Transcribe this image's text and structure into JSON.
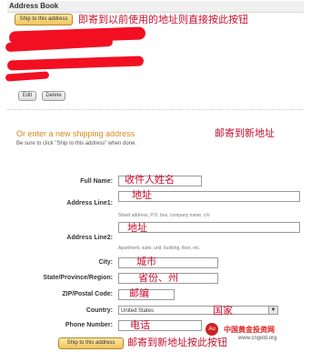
{
  "address_book": {
    "title": "Address Book",
    "ship_button": "Ship to this address",
    "annotation": "即寄到以前使用的地址则直接按此按钮",
    "edit_button": "Edit",
    "delete_button": "Delete"
  },
  "new_address": {
    "title": "Or enter a new shipping address",
    "annotation": "邮寄到新地址",
    "hint": "Be sure to click \"Ship to this address\" when done."
  },
  "form": {
    "full_name": {
      "label": "Full Name:",
      "annotation": "收件人姓名"
    },
    "address1": {
      "label": "Address Line1:",
      "annotation": "地址",
      "helper": "Street address, P.O. box, company name, c/o"
    },
    "address2": {
      "label": "Address Line2:",
      "annotation": "地址",
      "helper": "Apartment, suite, unit, building, floor, etc."
    },
    "city": {
      "label": "City:",
      "annotation": "城市"
    },
    "state": {
      "label": "State/Province/Region:",
      "annotation": "省份、州"
    },
    "zip": {
      "label": "ZIP/Postal Code:",
      "annotation": "邮编"
    },
    "country": {
      "label": "Country:",
      "value": "United States",
      "annotation": "国家"
    },
    "phone": {
      "label": "Phone Number:",
      "annotation": "电话"
    }
  },
  "submit": {
    "label": "Ship to this address",
    "annotation": "邮寄到新地址按此按钮"
  },
  "watermark": {
    "name": "中国黄金投资网",
    "url": "www.cngold.org"
  },
  "colors": {
    "redaction": "#f20f22",
    "annotation": "#c8102e",
    "section_title": "#d28a1a"
  }
}
